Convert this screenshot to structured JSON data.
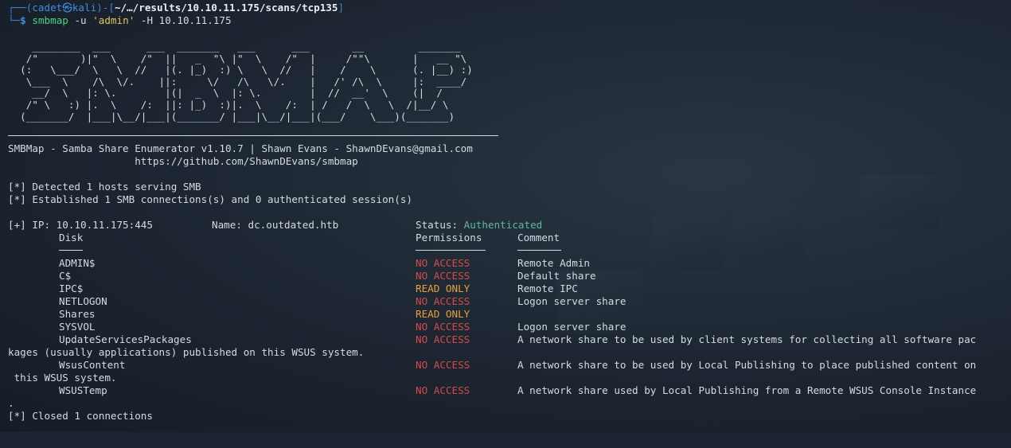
{
  "prompt": {
    "corner": "┌──(",
    "user": "cadet㉿kali",
    "sep": ")-[",
    "path": "~/…/results/10.10.11.175/scans/tcp135",
    "end": "]",
    "corner2": "└─",
    "dollar": "$",
    "cmd": "smbmap",
    "arg1": " -u ",
    "arg2": "'admin'",
    "arg3": " -H 10.10.11.175"
  },
  "banner_art": [
    "    ________  ___      ___  _______   ___      ___       __         _______",
    "   /\"       )|\"  \\    /\"  ||   _  \"\\ |\"  \\    /\"  |     /\"\"\\       |   __ \"\\",
    "  (:   \\___/  \\   \\  //   |(. |_)  :) \\   \\  //   |    /    \\      (. |__) :)",
    "   \\___  \\    /\\  \\/.    ||:     \\/   /\\   \\/.    |   /' /\\  \\     |:  ____/",
    "    __/  \\   |: \\.        |(|  _  \\  |: \\.        |  //  __'  \\    (|  /",
    "   /\" \\   :) |.  \\    /:  ||: |_)  :)|.  \\    /:  | /   /  \\   \\  /|__/ \\",
    "  (_______/  |___|\\__/|___|(_______/ |___|\\__/|___|(___/    \\___)(_______)"
  ],
  "banner": {
    "line1": "SMBMap - Samba Share Enumerator v1.10.7 | Shawn Evans - ShawnDEvans@gmail.com",
    "line2": "                     https://github.com/ShawnDEvans/smbmap"
  },
  "status": {
    "detected": "[*] Detected 1 hosts serving SMB",
    "established": "[*] Established 1 SMB connections(s) and 0 authenticated session(s)"
  },
  "host": {
    "ip": "[+] IP: 10.10.11.175:445",
    "name": "Name: dc.outdated.htb",
    "status_label": "Status: ",
    "status_value": "Authenticated"
  },
  "columns": {
    "disk": "Disk",
    "permissions": "Permissions",
    "comment": "Comment",
    "disk_rule": "----",
    "perm_rule": "-----------",
    "comment_rule": "-------"
  },
  "shares": [
    {
      "disk": "ADMIN$",
      "perm": "NO ACCESS",
      "perm_color": "#d54b4b",
      "comment": "Remote Admin"
    },
    {
      "disk": "C$",
      "perm": "NO ACCESS",
      "perm_color": "#d54b4b",
      "comment": "Default share"
    },
    {
      "disk": "IPC$",
      "perm": "READ ONLY",
      "perm_color": "#e8a13a",
      "comment": "Remote IPC"
    },
    {
      "disk": "NETLOGON",
      "perm": "NO ACCESS",
      "perm_color": "#d54b4b",
      "comment": "Logon server share"
    },
    {
      "disk": "Shares",
      "perm": "READ ONLY",
      "perm_color": "#e8a13a",
      "comment": ""
    },
    {
      "disk": "SYSVOL",
      "perm": "NO ACCESS",
      "perm_color": "#d54b4b",
      "comment": "Logon server share"
    },
    {
      "disk": "UpdateServicesPackages",
      "perm": "NO ACCESS",
      "perm_color": "#d54b4b",
      "comment": "A network share to be used by client systems for collecting all software pac",
      "wrap": "kages (usually applications) published on this WSUS system."
    },
    {
      "disk": "WsusContent",
      "perm": "NO ACCESS",
      "perm_color": "#d54b4b",
      "comment": "A network share to be used by Local Publishing to place published content on",
      "wrap": " this WSUS system."
    },
    {
      "disk": "WSUSTemp",
      "perm": "NO ACCESS",
      "perm_color": "#d54b4b",
      "comment": "A network share used by Local Publishing from a Remote WSUS Console Instance",
      "wrap": "."
    }
  ],
  "closed": "[*] Closed 1 connections"
}
